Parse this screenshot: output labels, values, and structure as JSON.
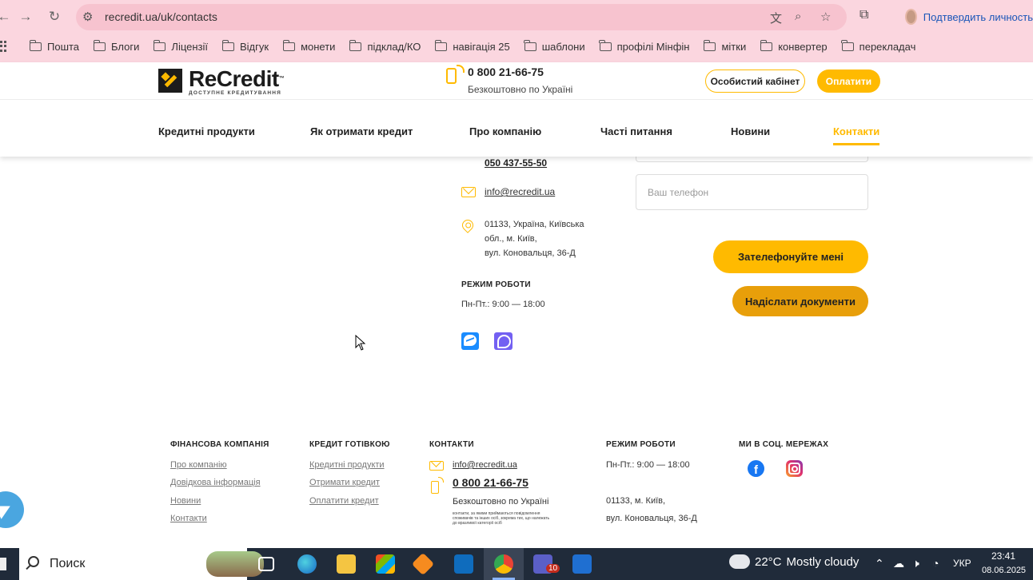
{
  "browser": {
    "url": "recredit.ua/uk/contacts",
    "profile_label": "Подтвердить личность",
    "bookmarks": [
      "Пошта",
      "Блоги",
      "Ліцензії",
      "Відгук",
      "монети",
      "підклад/КО",
      "навігація 25",
      "шаблони",
      "профілі Мінфін",
      "мітки",
      "конвертер",
      "перекладач"
    ]
  },
  "header": {
    "logo_name": "ReCredit",
    "logo_tm": "™",
    "logo_tagline": "ДОСТУПНЕ КРЕДИТУВАННЯ",
    "phone": "0 800 21-66-75",
    "phone_sub": "Безкоштовно по Україні",
    "cabinet_label": "Особистий кабінет",
    "pay_label": "Оплатити",
    "nav": [
      "Кредитні продукти",
      "Як отримати кредит",
      "Про компанію",
      "Часті питання",
      "Новини",
      "Контакти"
    ]
  },
  "contacts": {
    "phone2": "050 437-55-50",
    "email": "info@recredit.ua",
    "address_lines": [
      "01133, Україна, Київська",
      "обл., м. Київ,",
      "вул. Коновальця, 36-Д"
    ],
    "hours_title": "РЕЖИМ РОБОТИ",
    "hours": "Пн-Пт.: 9:00 — 18:00"
  },
  "form": {
    "phone_placeholder": "Ваш телефон",
    "call_label": "Зателефонуйте мені",
    "docs_label": "Надіслати документи"
  },
  "footer": {
    "col1_title": "ФІНАНСОВА КОМПАНІЯ",
    "col1_links": [
      "Про компанію",
      "Довідкова інформація",
      "Новини",
      "Контакти"
    ],
    "col2_title": "КРЕДИТ ГОТІВКОЮ",
    "col2_links": [
      "Кредитні продукти",
      "Отримати кредит",
      "Оплатити кредит"
    ],
    "col3_title": "КОНТАКТИ",
    "email": "info@recredit.ua",
    "phone": "0 800 21-66-75",
    "phone_sub": "Безкоштовно по Україні",
    "note": "контакти, за якими приймаються повідомлення споживачів та інших осіб, зокрема тих, що належать до вразливої категорії осіб",
    "col4_title": "РЕЖИМ РОБОТИ",
    "hours": "Пн-Пт.: 9:00 — 18:00",
    "addr1": "01133, м. Київ,",
    "addr2": "вул. Коновальця, 36-Д",
    "col5_title": "МИ В СОЦ. МЕРЕЖАХ",
    "fb_letter": "f"
  },
  "taskbar": {
    "search_text": "Поиск",
    "teams_badge": "10",
    "weather_temp": "22°C",
    "weather_text": "Mostly cloudy",
    "lang": "УКР",
    "time": "23:41",
    "date": "08.06.2025"
  },
  "colors": {
    "brand_yellow": "#ffba00",
    "docs_orange": "#e89f0a",
    "chrome_pink": "#fbd6df"
  }
}
